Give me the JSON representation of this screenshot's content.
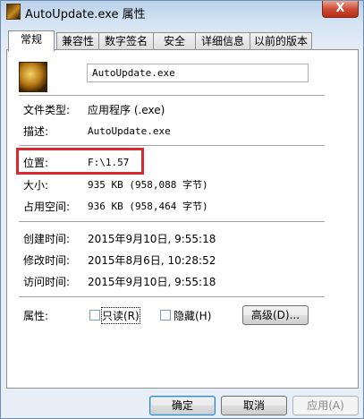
{
  "window": {
    "title": "AutoUpdate.exe 属性",
    "close_label": "X"
  },
  "tabs": [
    {
      "label": "常规",
      "active": true
    },
    {
      "label": "兼容性"
    },
    {
      "label": "数字签名"
    },
    {
      "label": "安全"
    },
    {
      "label": "详细信息"
    },
    {
      "label": "以前的版本"
    }
  ],
  "file": {
    "icon": "exe-app-icon",
    "name": "AutoUpdate.exe"
  },
  "props": {
    "type_label": "文件类型:",
    "type_value": "应用程序 (.exe)",
    "desc_label": "描述:",
    "desc_value": "AutoUpdate.exe",
    "location_label": "位置:",
    "location_value": "F:\\1.57",
    "size_label": "大小:",
    "size_value": "935 KB (958,088 字节)",
    "disk_label": "占用空间:",
    "disk_value": "936 KB (958,464 字节)",
    "created_label": "创建时间:",
    "created_value": "2015年9月10日, 9:55:18",
    "modified_label": "修改时间:",
    "modified_value": "2015年8月6日, 10:28:52",
    "accessed_label": "访问时间:",
    "accessed_value": "2015年9月10日, 9:55:18",
    "attr_label": "属性:",
    "readonly_label": "只读(R)",
    "hidden_label": "隐藏(H)",
    "advanced_label": "高级(D)..."
  },
  "buttons": {
    "ok": "确定",
    "cancel": "取消",
    "apply": "应用(A)"
  },
  "colors": {
    "highlight_box": "#d9282e",
    "close_button": "#cd4b36"
  }
}
